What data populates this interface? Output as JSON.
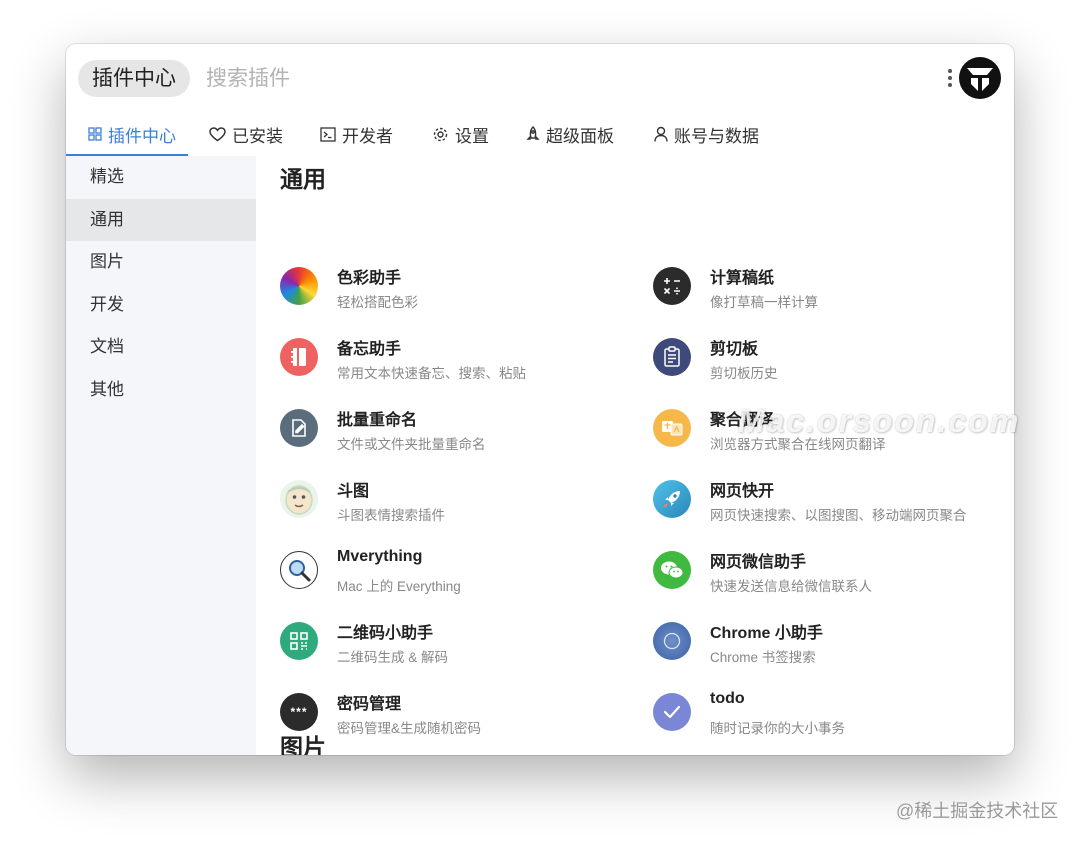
{
  "search": {
    "chip_label": "插件中心",
    "placeholder": "搜索插件"
  },
  "tabs": [
    {
      "label": "插件中心",
      "icon": "grid-icon",
      "active": true
    },
    {
      "label": "已安装",
      "icon": "heart-icon"
    },
    {
      "label": "开发者",
      "icon": "terminal-icon"
    },
    {
      "label": "设置",
      "icon": "gear-icon"
    },
    {
      "label": "超级面板",
      "icon": "rocket-icon"
    },
    {
      "label": "账号与数据",
      "icon": "user-icon"
    }
  ],
  "sidebar": {
    "items": [
      {
        "label": "精选"
      },
      {
        "label": "通用",
        "active": true
      },
      {
        "label": "图片"
      },
      {
        "label": "开发"
      },
      {
        "label": "文档"
      },
      {
        "label": "其他"
      }
    ]
  },
  "sections": [
    {
      "title": "通用"
    },
    {
      "title": "图片"
    }
  ],
  "plugins": [
    {
      "name": "色彩助手",
      "desc": "轻松搭配色彩",
      "icon": "color-wheel-icon"
    },
    {
      "name": "计算稿纸",
      "desc": "像打草稿一样计算",
      "icon": "calculator-icon"
    },
    {
      "name": "备忘助手",
      "desc": "常用文本快速备忘、搜索、粘贴",
      "icon": "notebook-icon"
    },
    {
      "name": "剪切板",
      "desc": "剪切板历史",
      "icon": "clipboard-icon"
    },
    {
      "name": "批量重命名",
      "desc": "文件或文件夹批量重命名",
      "icon": "rename-icon"
    },
    {
      "name": "聚合翻译",
      "desc": "浏览器方式聚合在线网页翻译",
      "icon": "translate-icon"
    },
    {
      "name": "斗图",
      "desc": "斗图表情搜索插件",
      "icon": "meme-face-icon"
    },
    {
      "name": "网页快开",
      "desc": "网页快速搜索、以图搜图、移动端网页聚合",
      "icon": "rocket-icon"
    },
    {
      "name": "Mverything",
      "desc": "Mac 上的 Everything",
      "icon": "magnifier-icon"
    },
    {
      "name": "网页微信助手",
      "desc": "快速发送信息给微信联系人",
      "icon": "wechat-icon"
    },
    {
      "name": "二维码小助手",
      "desc": "二维码生成 & 解码",
      "icon": "qrcode-icon"
    },
    {
      "name": "Chrome 小助手",
      "desc": "Chrome 书签搜索",
      "icon": "chrome-icon"
    },
    {
      "name": "密码管理",
      "desc": "密码管理&生成随机密码",
      "icon": "password-icon"
    },
    {
      "name": "todo",
      "desc": "随时记录你的大小事务",
      "icon": "check-icon"
    }
  ],
  "watermark": "Mac.orsoon.com",
  "credit": "@稀土掘金技术社区",
  "colors": {
    "accent": "#3d7fd6"
  }
}
